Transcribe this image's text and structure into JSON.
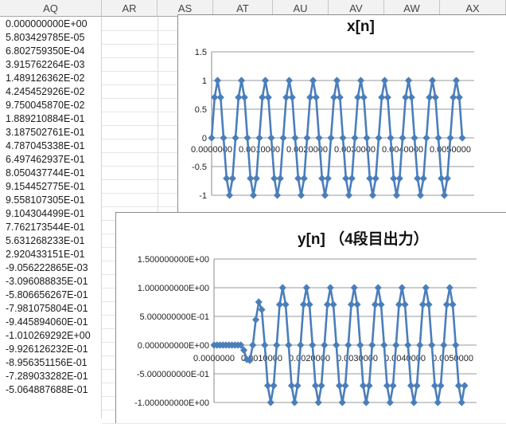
{
  "columns": [
    "AQ",
    "AR",
    "AS",
    "AT",
    "AU",
    "AV",
    "AW",
    "AX"
  ],
  "aq_values": [
    "0.000000000E+00",
    "5.803429785E-05",
    "6.802759350E-04",
    "3.915762264E-03",
    "1.489126362E-02",
    "4.245452926E-02",
    "9.750045870E-02",
    "1.889210884E-01",
    "3.187502761E-01",
    "4.787045338E-01",
    "6.497462937E-01",
    "8.050437744E-01",
    "9.154452775E-01",
    "9.558107305E-01",
    "9.104304499E-01",
    "7.762173544E-01",
    "5.631268233E-01",
    "2.920433151E-01",
    "-9.056222865E-03",
    "-3.096088835E-01",
    "-5.806656267E-01",
    "-7.981075804E-01",
    "-9.445894060E-01",
    "-1.010269292E+00",
    "-9.926126232E-01",
    "-8.956351156E-01",
    "-7.289033282E-01",
    "-5.064887688E-01"
  ],
  "chart_data": [
    {
      "type": "scatter",
      "title": "x[n]",
      "x_ticks": [
        "0.0000000",
        "0.0010000",
        "0.0020000",
        "0.0030000",
        "0.0040000",
        "0.0050000"
      ],
      "y_ticks": [
        "1.5",
        "1",
        "0.5",
        "0",
        "-0.5",
        "-1"
      ],
      "xlim": [
        0,
        0.0055
      ],
      "ylim": [
        -1,
        1.5
      ],
      "signal": {
        "frequency_hz": 2000,
        "amplitude": 1,
        "sample_period": 6.25e-05,
        "n_samples": 85
      },
      "color": "#4a7ebb"
    },
    {
      "type": "scatter",
      "title": "y[n] （4段目出力）",
      "x_ticks": [
        "0.0000000",
        "0.0010000",
        "0.0020000",
        "0.0030000",
        "0.0040000",
        "0.0050000"
      ],
      "y_ticks": [
        "1.500000000E+00",
        "1.000000000E+00",
        "5.000000000E-01",
        "0.000000000E+00",
        "-5.000000000E-01",
        "-1.000000000E+00"
      ],
      "xlim": [
        0,
        0.0055
      ],
      "ylim": [
        -1,
        1.5
      ],
      "signal": {
        "frequency_hz": 2000,
        "amplitude": 1,
        "sample_period": 6.25e-05,
        "n_samples": 85,
        "delay_samples": 9
      },
      "color": "#4a7ebb"
    }
  ]
}
